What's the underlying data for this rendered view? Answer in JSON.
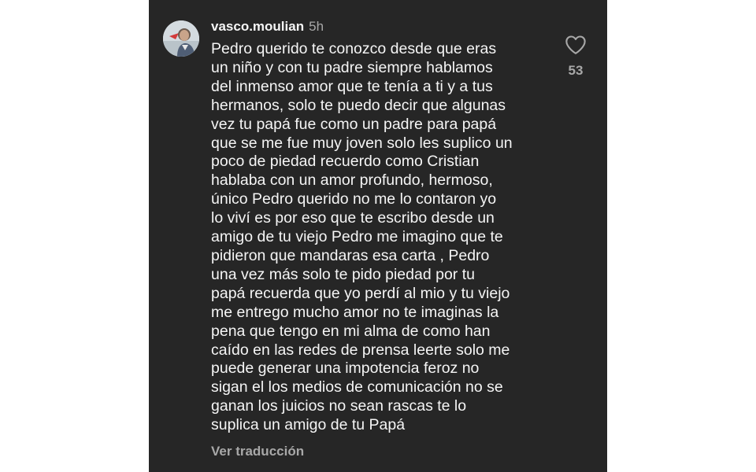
{
  "comment": {
    "username": "vasco.moulian",
    "timestamp": "5h",
    "text": "Pedro querido te conozco desde que eras\nun niño y con tu padre siempre hablamos\ndel inmenso amor que te tenía a ti y a tus\nhermanos, solo te puedo decir que algunas\nvez tu papá fue como un padre para papá\nque se me fue muy joven solo les suplico un\npoco de piedad recuerdo como Cristian\nhablaba con un amor profundo, hermoso,\núnico Pedro querido no me lo contaron yo\nlo viví es por eso que te escribo desde un\namigo de tu viejo Pedro me imagino que te\npidieron que mandaras esa carta , Pedro\nuna vez más solo te pido piedad por tu\npapá recuerda que yo perdí al mio y tu viejo\nme entrego mucho amor no te imaginas la\npena que tengo en mi alma de como han\ncaído en las redes de prensa leerte solo me\npuede generar una impotencia feroz no\nsigan el los medios de comunicación no se\nganan los juicios no sean rascas te lo\nsuplica un amigo de tu Papá",
    "translate_label": "Ver traducción",
    "like_icon": "heart-outline-icon",
    "like_count": "53"
  },
  "colors": {
    "background": "#262626",
    "primary_text": "#f5f5f5",
    "secondary_text": "#a8a8a8"
  }
}
